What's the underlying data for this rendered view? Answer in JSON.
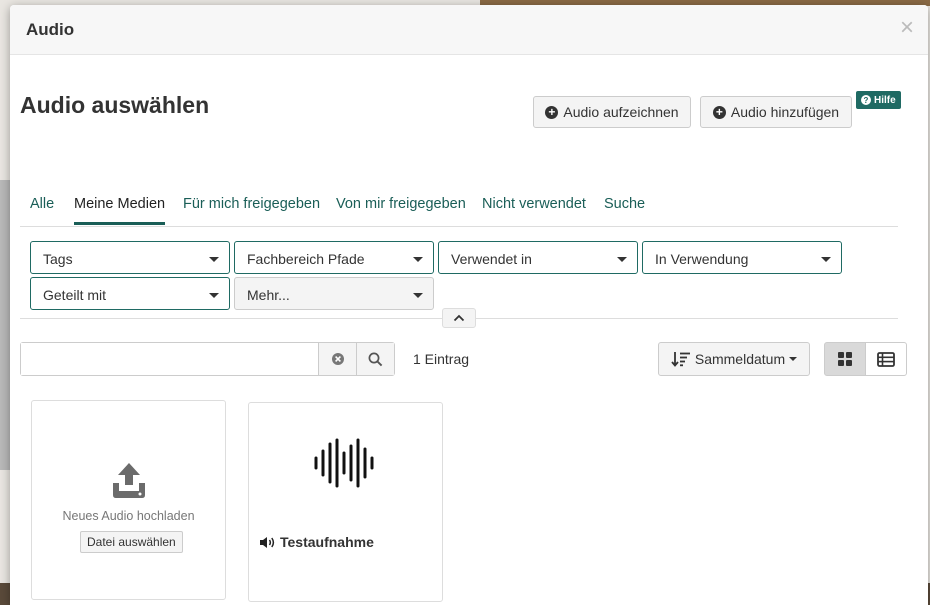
{
  "modal": {
    "title": "Audio",
    "close_symbol": "×"
  },
  "page": {
    "title": "Audio auswählen"
  },
  "actions": {
    "record_label": "Audio aufzeichnen",
    "add_label": "Audio hinzufügen",
    "help_label": "Hilfe"
  },
  "tabs": [
    {
      "label": "Alle",
      "active": false
    },
    {
      "label": "Meine Medien",
      "active": true
    },
    {
      "label": "Für mich freigegeben",
      "active": false
    },
    {
      "label": "Von mir freigegeben",
      "active": false
    },
    {
      "label": "Nicht verwendet",
      "active": false
    },
    {
      "label": "Suche",
      "active": false
    }
  ],
  "filters": [
    {
      "label": "Tags"
    },
    {
      "label": "Fachbereich Pfade"
    },
    {
      "label": "Verwendet in"
    },
    {
      "label": "In Verwendung"
    },
    {
      "label": "Geteilt mit"
    },
    {
      "label": "Mehr..."
    }
  ],
  "search": {
    "value": "",
    "placeholder": ""
  },
  "results": {
    "count_label": "1 Eintrag"
  },
  "sort": {
    "label": "Sammeldatum"
  },
  "view_modes": {
    "active": "grid"
  },
  "cards": {
    "upload": {
      "label": "Neues Audio hochladen",
      "button_label": "Datei auswählen"
    },
    "item": {
      "title": "Testaufnahme"
    }
  },
  "colors": {
    "accent": "#1f6a63",
    "link": "#1a5e57"
  }
}
